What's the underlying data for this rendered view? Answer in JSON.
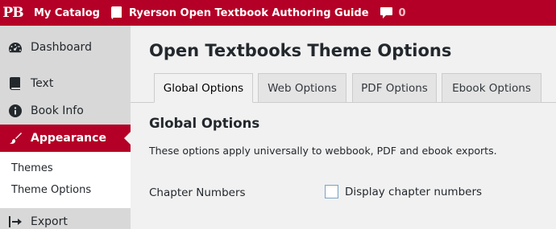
{
  "adminbar": {
    "logo": "PB",
    "catalog": "My Catalog",
    "book": "Ryerson Open Textbook Authoring Guide",
    "comments_count": "0",
    "colors": {
      "background": "#b40026"
    },
    "icons": [
      "pressbooks-logo-icon",
      "book-icon",
      "comment-icon"
    ]
  },
  "sidebar": {
    "items": [
      {
        "label": "Dashboard",
        "icon": "dashboard-icon"
      },
      {
        "label": "Text",
        "icon": "book-icon"
      },
      {
        "label": "Book Info",
        "icon": "info-icon"
      },
      {
        "label": "Appearance",
        "icon": "paintbrush-icon",
        "active": true
      },
      {
        "label": "Export",
        "icon": "export-icon"
      }
    ],
    "submenu": [
      "Themes",
      "Theme Options"
    ]
  },
  "main": {
    "title": "Open Textbooks Theme Options",
    "tabs": [
      "Global Options",
      "Web Options",
      "PDF Options",
      "Ebook Options"
    ],
    "active_tab": "Global Options",
    "section_title": "Global Options",
    "section_desc": "These options apply universally to webbook, PDF and ebook exports.",
    "field_label": "Chapter Numbers",
    "checkbox_label": "Display chapter numbers",
    "checkbox_checked": false
  }
}
